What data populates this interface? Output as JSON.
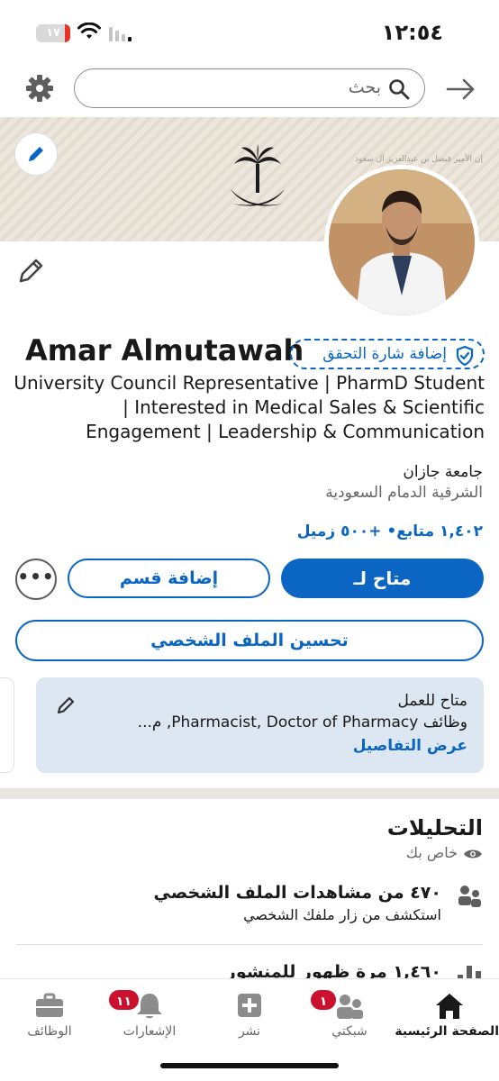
{
  "status_bar": {
    "time": "١٢:٥٤",
    "battery": "١٧",
    "battery_level": 0.17,
    "icons": [
      "battery-icon",
      "wifi-icon",
      "signal-icon"
    ]
  },
  "top_bar": {
    "search_placeholder": "بحث",
    "icons": [
      "gear-icon",
      "search-icon",
      "arrow-right-icon"
    ]
  },
  "profile": {
    "name": "Amar Almutawah",
    "verify_label": "إضافة شارة التحقق",
    "headline": "University Council Representative | PharmD Student | Interested in Medical Sales & Scientific Engagement | Leadership & Communication",
    "education": "جامعة جازان",
    "location": "الشرقية الدمام السعودية",
    "connections": "١,٤٠٢ متابع• +٥٠٠ زميل",
    "banner_text": "إن الأمير فيصل بن عبدالعزيز آل سعود"
  },
  "actions": {
    "open_to": "متاح لـ",
    "add_section": "إضافة قسم",
    "more": "•••",
    "enhance_profile": "تحسين الملف الشخصي"
  },
  "open_to_work": {
    "title": "متاح للعمل",
    "description": "وظائف Pharmacist, Doctor of Pharmacy, م...",
    "link": "عرض التفاصيل"
  },
  "analytics": {
    "title": "التحليلات",
    "private_label": "خاص بك",
    "profile_views": "٤٧٠ من مشاهدات الملف الشخصي",
    "profile_views_sub": "استكشف من زار ملفك الشخصي",
    "post_impressions": "١,٤٦٠ مرة ظهور للمنشور"
  },
  "bottom_nav": {
    "items": [
      {
        "label": "الصفحة الرئيسية",
        "icon": "home-icon",
        "active": true
      },
      {
        "label": "شبكتي",
        "icon": "network-icon",
        "badge": "١"
      },
      {
        "label": "نشر",
        "icon": "post-icon"
      },
      {
        "label": "الإشعارات",
        "icon": "bell-icon",
        "badge": "١١"
      },
      {
        "label": "الوظائف",
        "icon": "briefcase-icon"
      }
    ]
  },
  "colors": {
    "primary": "#0a66c2",
    "badge": "#cb112d",
    "card_bg": "#dde7f1"
  }
}
